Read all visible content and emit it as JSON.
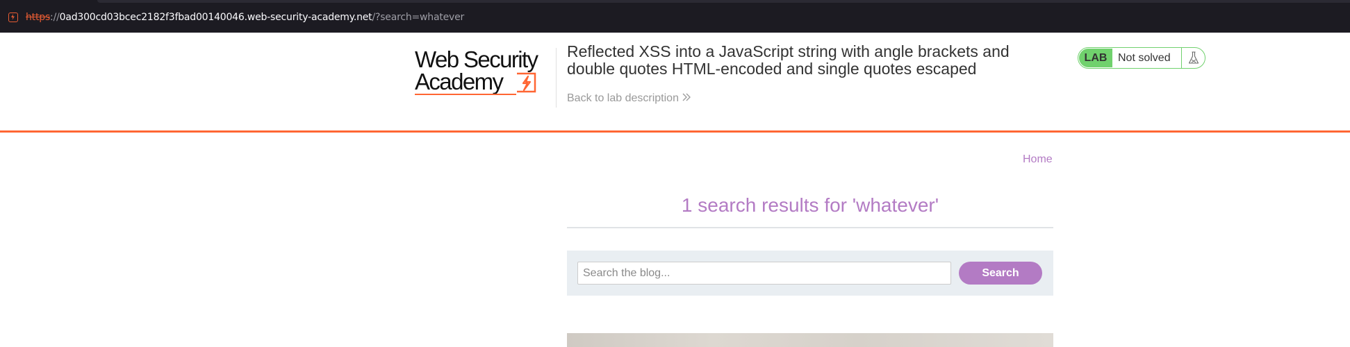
{
  "browser": {
    "url_scheme": "https",
    "url_separator": "://",
    "url_host": "0ad300cd03bcec2182f3fbad00140046.web-security-academy.net",
    "url_path": "/?search=whatever",
    "site_icon": "lightning-icon"
  },
  "header": {
    "logo_line1": "Web Security",
    "logo_line2": "Academy",
    "logo_icon": "lightning-bolt-icon",
    "lab_title": "Reflected XSS into a JavaScript string with angle brackets and double quotes HTML-encoded and single quotes escaped",
    "back_link": "Back to lab description",
    "lab_badge": "LAB",
    "lab_status": "Not solved",
    "lab_status_icon": "flask-icon"
  },
  "nav": {
    "home_label": "Home"
  },
  "main": {
    "results_heading": "1 search results for 'whatever'",
    "search_placeholder": "Search the blog...",
    "search_button": "Search"
  },
  "colors": {
    "accent_orange": "#ff6633",
    "accent_purple": "#b37bc4",
    "lab_green": "#70d16d"
  }
}
